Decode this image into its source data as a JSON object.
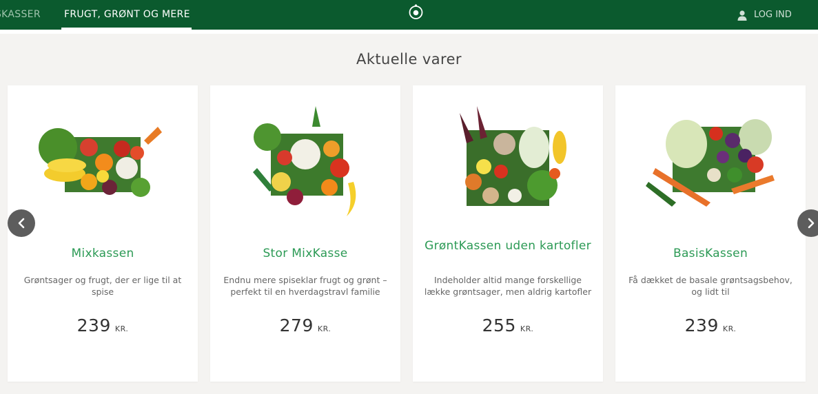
{
  "header": {
    "nav_left_label": "SKASSER",
    "nav_active_label": "FRUGT, GRØNT OG MERE",
    "login_label": "LOG IND"
  },
  "section": {
    "title": "Aktuelle varer"
  },
  "products": [
    {
      "name": "Mixkassen",
      "description": "Grøntsager og frugt, der er lige til at spise",
      "price": "239",
      "currency": "KR."
    },
    {
      "name": "Stor MixKasse",
      "description": "Endnu mere spiseklar frugt og grønt – perfekt til en hverdagstravl familie",
      "price": "279",
      "currency": "KR."
    },
    {
      "name": "GrøntKassen uden kartofler",
      "description": "Indeholder altid mange forskellige lække grøntsager, men aldrig kartofler",
      "price": "255",
      "currency": "KR."
    },
    {
      "name": "BasisKassen",
      "description": "Få dækket de basale grøntsagsbehov, og lidt til",
      "price": "239",
      "currency": "KR."
    }
  ],
  "colors": {
    "header_bg": "#0b5a2e",
    "accent": "#2c9a55",
    "page_bg": "#f4f3f1"
  },
  "icons": {
    "logo": "at-sign-logo",
    "login": "user-icon",
    "prev": "chevron-left-icon",
    "next": "chevron-right-icon"
  }
}
